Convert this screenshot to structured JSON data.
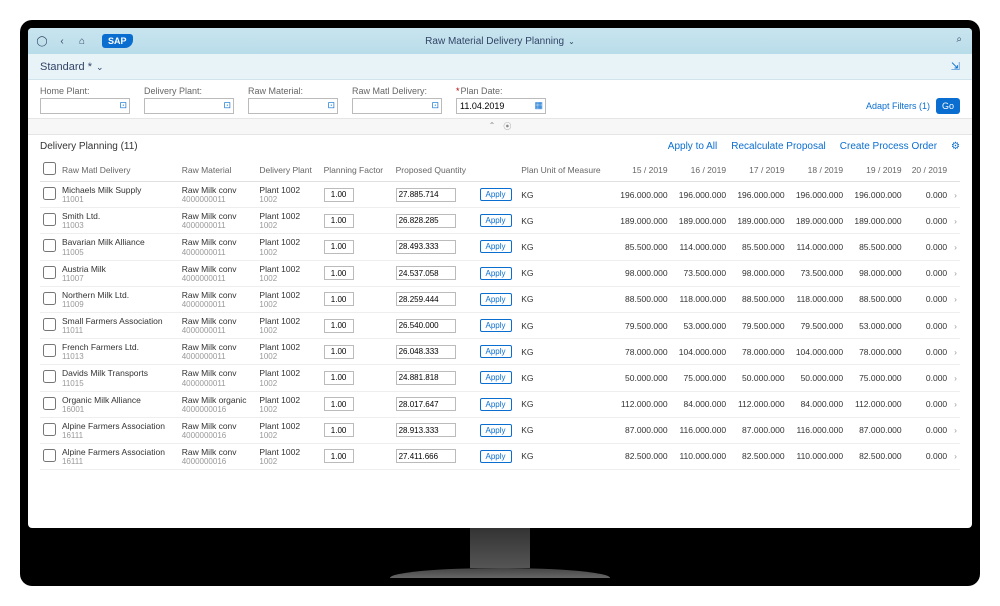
{
  "shell": {
    "title": "Raw Material Delivery Planning",
    "logo": "SAP"
  },
  "variant": {
    "label": "Standard *"
  },
  "filters": {
    "home_plant": {
      "label": "Home Plant:"
    },
    "delivery_plant": {
      "label": "Delivery Plant:"
    },
    "raw_material": {
      "label": "Raw Material:"
    },
    "raw_matl_delivery": {
      "label": "Raw Matl Delivery:"
    },
    "plan_date": {
      "label": "Plan Date:",
      "value": "11.04.2019"
    },
    "adapt": "Adapt Filters (1)",
    "go": "Go"
  },
  "table": {
    "title": "Delivery Planning (11)",
    "actions": {
      "apply_all": "Apply to All",
      "recalc": "Recalculate Proposal",
      "create": "Create Process Order"
    },
    "columns": {
      "chk": "",
      "delivery": "Raw Matl Delivery",
      "material": "Raw Material",
      "plant": "Delivery Plant",
      "factor": "Planning Factor",
      "proposed": "Proposed Quantity",
      "apply": "",
      "uom": "Plan Unit of Measure",
      "p15": "15 / 2019",
      "p16": "16 / 2019",
      "p17": "17 / 2019",
      "p18": "18 / 2019",
      "p19": "19 / 2019",
      "p20": "20 / 2019"
    },
    "apply_label": "Apply",
    "rows": [
      {
        "delivery": "Michaels Milk Supply",
        "delivery_id": "11001",
        "material": "Raw Milk conv",
        "material_id": "4000000011",
        "plant": "Plant 1002",
        "plant_id": "1002",
        "factor": "1.00",
        "proposed": "27.885.714",
        "uom": "KG",
        "p15": "196.000.000",
        "p16": "196.000.000",
        "p17": "196.000.000",
        "p18": "196.000.000",
        "p19": "196.000.000",
        "p20": "0.000"
      },
      {
        "delivery": "Smith Ltd.",
        "delivery_id": "11003",
        "material": "Raw Milk conv",
        "material_id": "4000000011",
        "plant": "Plant 1002",
        "plant_id": "1002",
        "factor": "1.00",
        "proposed": "26.828.285",
        "uom": "KG",
        "p15": "189.000.000",
        "p16": "189.000.000",
        "p17": "189.000.000",
        "p18": "189.000.000",
        "p19": "189.000.000",
        "p20": "0.000"
      },
      {
        "delivery": "Bavarian Milk Alliance",
        "delivery_id": "11005",
        "material": "Raw Milk conv",
        "material_id": "4000000011",
        "plant": "Plant 1002",
        "plant_id": "1002",
        "factor": "1.00",
        "proposed": "28.493.333",
        "uom": "KG",
        "p15": "85.500.000",
        "p16": "114.000.000",
        "p17": "85.500.000",
        "p18": "114.000.000",
        "p19": "85.500.000",
        "p20": "0.000"
      },
      {
        "delivery": "Austria Milk",
        "delivery_id": "11007",
        "material": "Raw Milk conv",
        "material_id": "4000000011",
        "plant": "Plant 1002",
        "plant_id": "1002",
        "factor": "1.00",
        "proposed": "24.537.058",
        "uom": "KG",
        "p15": "98.000.000",
        "p16": "73.500.000",
        "p17": "98.000.000",
        "p18": "73.500.000",
        "p19": "98.000.000",
        "p20": "0.000"
      },
      {
        "delivery": "Northern Milk Ltd.",
        "delivery_id": "11009",
        "material": "Raw Milk conv",
        "material_id": "4000000011",
        "plant": "Plant 1002",
        "plant_id": "1002",
        "factor": "1.00",
        "proposed": "28.259.444",
        "uom": "KG",
        "p15": "88.500.000",
        "p16": "118.000.000",
        "p17": "88.500.000",
        "p18": "118.000.000",
        "p19": "88.500.000",
        "p20": "0.000"
      },
      {
        "delivery": "Small Farmers Association",
        "delivery_id": "11011",
        "material": "Raw Milk conv",
        "material_id": "4000000011",
        "plant": "Plant 1002",
        "plant_id": "1002",
        "factor": "1.00",
        "proposed": "26.540.000",
        "uom": "KG",
        "p15": "79.500.000",
        "p16": "53.000.000",
        "p17": "79.500.000",
        "p18": "79.500.000",
        "p19": "53.000.000",
        "p20": "0.000"
      },
      {
        "delivery": "French Farmers Ltd.",
        "delivery_id": "11013",
        "material": "Raw Milk conv",
        "material_id": "4000000011",
        "plant": "Plant 1002",
        "plant_id": "1002",
        "factor": "1.00",
        "proposed": "26.048.333",
        "uom": "KG",
        "p15": "78.000.000",
        "p16": "104.000.000",
        "p17": "78.000.000",
        "p18": "104.000.000",
        "p19": "78.000.000",
        "p20": "0.000"
      },
      {
        "delivery": "Davids Milk Transports",
        "delivery_id": "11015",
        "material": "Raw Milk conv",
        "material_id": "4000000011",
        "plant": "Plant 1002",
        "plant_id": "1002",
        "factor": "1.00",
        "proposed": "24.881.818",
        "uom": "KG",
        "p15": "50.000.000",
        "p16": "75.000.000",
        "p17": "50.000.000",
        "p18": "50.000.000",
        "p19": "75.000.000",
        "p20": "0.000"
      },
      {
        "delivery": "Organic Milk Alliance",
        "delivery_id": "16001",
        "material": "Raw Milk organic",
        "material_id": "4000000016",
        "plant": "Plant 1002",
        "plant_id": "1002",
        "factor": "1.00",
        "proposed": "28.017.647",
        "uom": "KG",
        "p15": "112.000.000",
        "p16": "84.000.000",
        "p17": "112.000.000",
        "p18": "84.000.000",
        "p19": "112.000.000",
        "p20": "0.000"
      },
      {
        "delivery": "Alpine Farmers Association",
        "delivery_id": "16111",
        "material": "Raw Milk conv",
        "material_id": "4000000016",
        "plant": "Plant 1002",
        "plant_id": "1002",
        "factor": "1.00",
        "proposed": "28.913.333",
        "uom": "KG",
        "p15": "87.000.000",
        "p16": "116.000.000",
        "p17": "87.000.000",
        "p18": "116.000.000",
        "p19": "87.000.000",
        "p20": "0.000"
      },
      {
        "delivery": "Alpine Farmers Association",
        "delivery_id": "16111",
        "material": "Raw Milk conv",
        "material_id": "4000000016",
        "plant": "Plant 1002",
        "plant_id": "1002",
        "factor": "1.00",
        "proposed": "27.411.666",
        "uom": "KG",
        "p15": "82.500.000",
        "p16": "110.000.000",
        "p17": "82.500.000",
        "p18": "110.000.000",
        "p19": "82.500.000",
        "p20": "0.000"
      }
    ]
  }
}
